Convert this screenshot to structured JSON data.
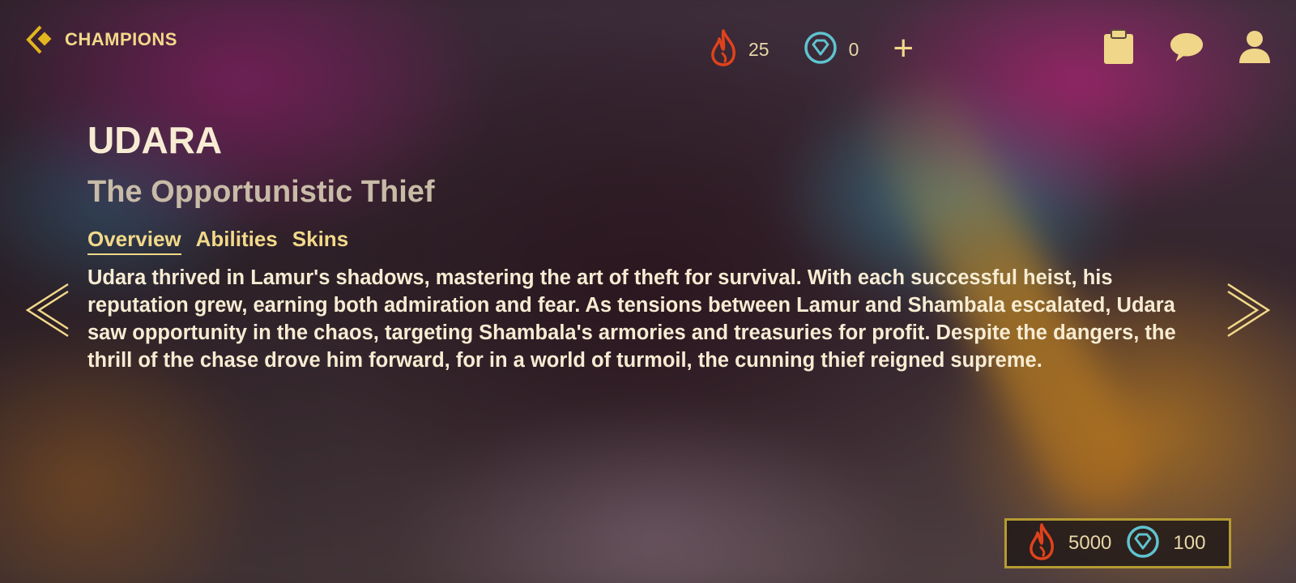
{
  "header": {
    "back_label": "CHAMPIONS",
    "currency": {
      "fire": {
        "icon": "fire-icon",
        "value": "25",
        "color": "#e0421c"
      },
      "gem": {
        "icon": "gem-icon",
        "value": "0",
        "color": "#5fc3d0"
      },
      "add_icon": "plus-icon"
    },
    "icons": [
      "clipboard-icon",
      "chat-icon",
      "user-icon"
    ]
  },
  "champion": {
    "name": "UDARA",
    "title": "The Opportunistic Thief",
    "tabs": [
      {
        "label": "Overview",
        "active": true
      },
      {
        "label": "Abilities",
        "active": false
      },
      {
        "label": "Skins",
        "active": false
      }
    ],
    "lore": "Udara thrived in Lamur's shadows, mastering the art of theft for survival. With each successful heist, his reputation grew, earning both admiration and fear. As tensions between Lamur and Shambala escalated, Udara saw opportunity in the chaos, targeting Shambala's armories and treasuries for profit. Despite the dangers, the thrill of the chase drove him forward, for in a world of turmoil, the cunning thief reigned supreme."
  },
  "navigation": {
    "prev_icon": "chevron-left-icon",
    "next_icon": "chevron-right-icon"
  },
  "price": {
    "fire_value": "5000",
    "gem_value": "100",
    "border_color": "#b59b33"
  },
  "theme": {
    "accent": "#f2d98a",
    "text": "#f7ecd3"
  }
}
